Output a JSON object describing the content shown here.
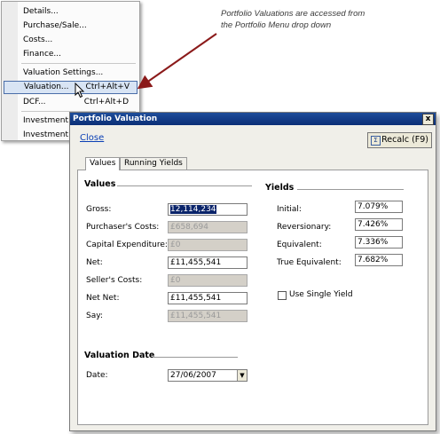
{
  "menu": {
    "items": [
      {
        "label": "Details...",
        "shortcut": ""
      },
      {
        "label": "Purchase/Sale...",
        "shortcut": ""
      },
      {
        "label": "Costs...",
        "shortcut": ""
      },
      {
        "label": "Finance...",
        "shortcut": ""
      },
      {
        "label": "Valuation Settings...",
        "shortcut": ""
      },
      {
        "label": "Valuation...",
        "shortcut": "Ctrl+Alt+V"
      },
      {
        "label": "DCF...",
        "shortcut": "Ctrl+Alt+D"
      },
      {
        "label": "Investment Co",
        "shortcut": ""
      },
      {
        "label": "Investment Co",
        "shortcut": ""
      }
    ]
  },
  "callout": {
    "line1": "Portfolio Valuations are accessed from",
    "line2": "the Portfolio Menu drop down"
  },
  "dialog": {
    "title": "Portfolio Valuation",
    "close_x": "x",
    "close_link": "Close",
    "recalc_label": "Recalc (F9)",
    "recalc_symbol": "Σ",
    "tabs": [
      "Values",
      "Running Yields"
    ],
    "values_heading": "Values",
    "yields_heading": "Yields",
    "values": [
      {
        "label": "Gross:",
        "value": "12,114,234",
        "enabled": true,
        "selected": true
      },
      {
        "label": "Purchaser's Costs:",
        "value": "£658,694",
        "enabled": false
      },
      {
        "label": "Capital Expenditure:",
        "value": "£0",
        "enabled": false
      },
      {
        "label": "Net:",
        "value": "£11,455,541",
        "enabled": true
      },
      {
        "label": "Seller's Costs:",
        "value": "£0",
        "enabled": false
      },
      {
        "label": "Net Net:",
        "value": "£11,455,541",
        "enabled": true
      },
      {
        "label": "Say:",
        "value": "£11,455,541",
        "enabled": false
      }
    ],
    "yields": [
      {
        "label": "Initial:",
        "value": "7.079%"
      },
      {
        "label": "Reversionary:",
        "value": "7.426%"
      },
      {
        "label": "Equivalent:",
        "value": "7.336%"
      },
      {
        "label": "True Equivalent:",
        "value": "7.682%"
      }
    ],
    "single_yield_label": "Use Single Yield",
    "single_yield_checked": false,
    "valuation_date_heading": "Valuation Date",
    "date_label": "Date:",
    "date_value": "27/06/2007"
  }
}
